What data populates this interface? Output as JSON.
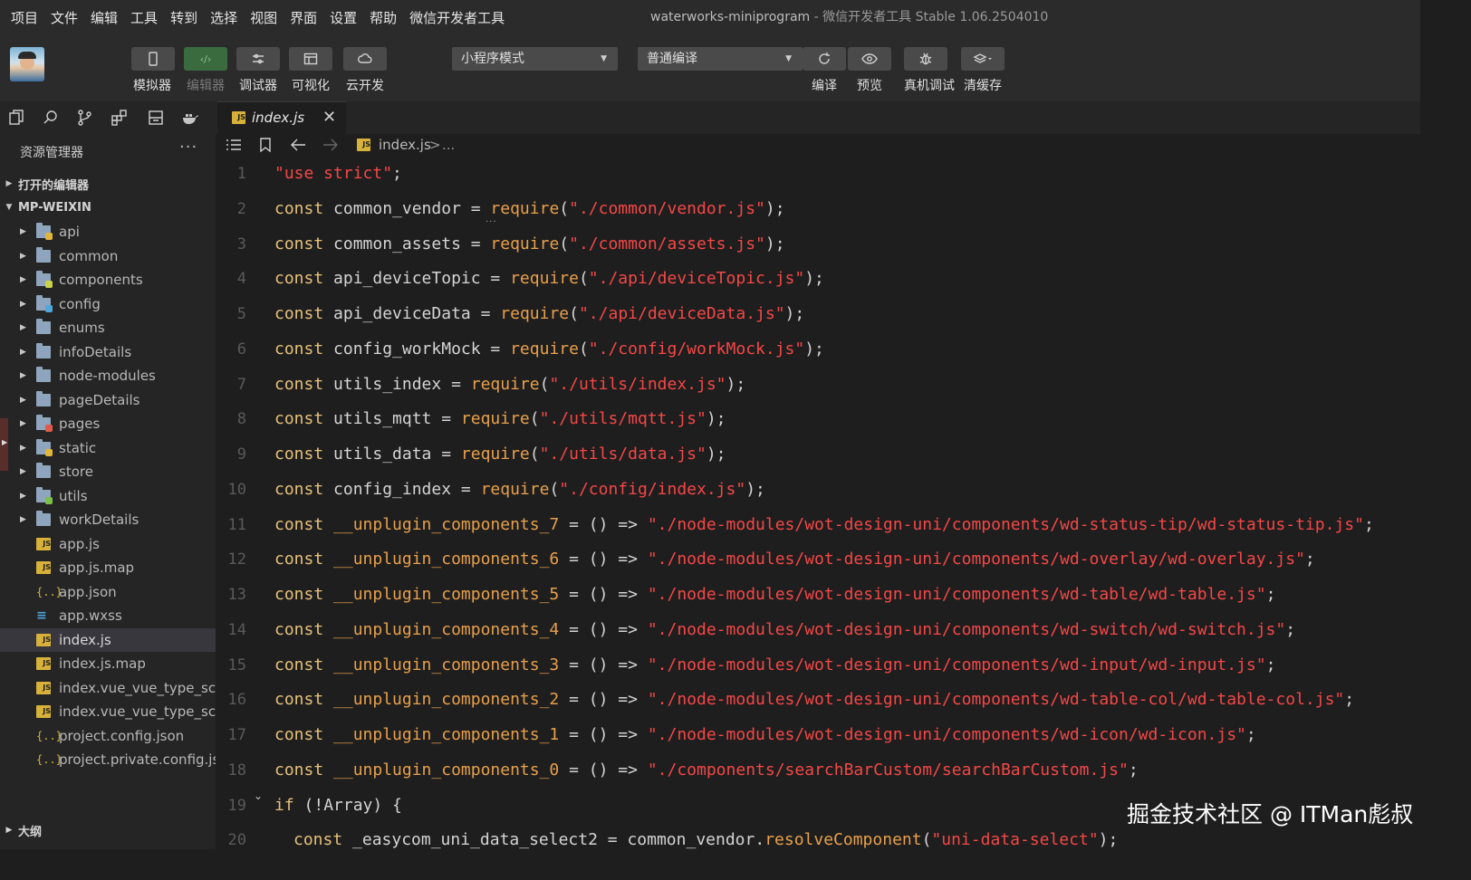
{
  "menu": [
    "项目",
    "文件",
    "编辑",
    "工具",
    "转到",
    "选择",
    "视图",
    "界面",
    "设置",
    "帮助",
    "微信开发者工具"
  ],
  "window_title": {
    "main": "waterworks-miniprogram",
    "rest": " - 微信开发者工具 Stable 1.06.2504010"
  },
  "toolbar": {
    "simulator": "模拟器",
    "editor": "编辑器",
    "debugger": "调试器",
    "visual": "可视化",
    "cloud": "云开发",
    "mode": "小程序模式",
    "compile_mode": "普通编译",
    "compile": "编译",
    "preview": "预览",
    "real_debug": "真机调试",
    "clear_cache": "清缓存"
  },
  "sidebar": {
    "title": "资源管理器",
    "more": "···",
    "open_editors": "打开的编辑器",
    "project": "MP-WEIXIN",
    "outline": "大纲",
    "items": [
      {
        "name": "api",
        "kind": "folder",
        "badge": "#e0b53a"
      },
      {
        "name": "common",
        "kind": "folder",
        "badge": ""
      },
      {
        "name": "components",
        "kind": "folder",
        "badge": "#c8d24a"
      },
      {
        "name": "config",
        "kind": "folder",
        "badge": "#4ea6dc"
      },
      {
        "name": "enums",
        "kind": "folder",
        "badge": ""
      },
      {
        "name": "infoDetails",
        "kind": "folder",
        "badge": ""
      },
      {
        "name": "node-modules",
        "kind": "folder",
        "badge": ""
      },
      {
        "name": "pageDetails",
        "kind": "folder",
        "badge": ""
      },
      {
        "name": "pages",
        "kind": "folder",
        "badge": "#e05a4a"
      },
      {
        "name": "static",
        "kind": "folder",
        "badge": "#e0b53a"
      },
      {
        "name": "store",
        "kind": "folder",
        "badge": ""
      },
      {
        "name": "utils",
        "kind": "folder",
        "badge": "#7cc04a"
      },
      {
        "name": "workDetails",
        "kind": "folder",
        "badge": ""
      },
      {
        "name": "app.js",
        "kind": "js"
      },
      {
        "name": "app.js.map",
        "kind": "js"
      },
      {
        "name": "app.json",
        "kind": "json"
      },
      {
        "name": "app.wxss",
        "kind": "css"
      },
      {
        "name": "index.js",
        "kind": "js",
        "selected": true
      },
      {
        "name": "index.js.map",
        "kind": "js"
      },
      {
        "name": "index.vue_vue_type_scr...",
        "kind": "js"
      },
      {
        "name": "index.vue_vue_type_scr...",
        "kind": "js"
      },
      {
        "name": "project.config.json",
        "kind": "json"
      },
      {
        "name": "project.private.config.js...",
        "kind": "json"
      }
    ]
  },
  "editor": {
    "tab": "index.js",
    "breadcrumb_file": "index.js",
    "breadcrumb_sep": ">",
    "breadcrumb_more": "...",
    "lines": [
      [
        [
          "s",
          "\"use strict\""
        ],
        [
          "n",
          ";"
        ]
      ],
      [
        [
          "k",
          "const"
        ],
        [
          "v",
          " common_vendor = "
        ],
        [
          "f",
          "require"
        ],
        [
          "n",
          "("
        ],
        [
          "s",
          "\"./common/vendor.js\""
        ],
        [
          "n",
          ");"
        ]
      ],
      [
        [
          "k",
          "const"
        ],
        [
          "v",
          " common_assets = "
        ],
        [
          "f",
          "require"
        ],
        [
          "n",
          "("
        ],
        [
          "s",
          "\"./common/assets.js\""
        ],
        [
          "n",
          ");"
        ]
      ],
      [
        [
          "k",
          "const"
        ],
        [
          "v",
          " api_deviceTopic = "
        ],
        [
          "f",
          "require"
        ],
        [
          "n",
          "("
        ],
        [
          "s",
          "\"./api/deviceTopic.js\""
        ],
        [
          "n",
          ");"
        ]
      ],
      [
        [
          "k",
          "const"
        ],
        [
          "v",
          " api_deviceData = "
        ],
        [
          "f",
          "require"
        ],
        [
          "n",
          "("
        ],
        [
          "s",
          "\"./api/deviceData.js\""
        ],
        [
          "n",
          ");"
        ]
      ],
      [
        [
          "k",
          "const"
        ],
        [
          "v",
          " config_workMock = "
        ],
        [
          "f",
          "require"
        ],
        [
          "n",
          "("
        ],
        [
          "s",
          "\"./config/workMock.js\""
        ],
        [
          "n",
          ");"
        ]
      ],
      [
        [
          "k",
          "const"
        ],
        [
          "v",
          " utils_index = "
        ],
        [
          "f",
          "require"
        ],
        [
          "n",
          "("
        ],
        [
          "s",
          "\"./utils/index.js\""
        ],
        [
          "n",
          ");"
        ]
      ],
      [
        [
          "k",
          "const"
        ],
        [
          "v",
          " utils_mqtt = "
        ],
        [
          "f",
          "require"
        ],
        [
          "n",
          "("
        ],
        [
          "s",
          "\"./utils/mqtt.js\""
        ],
        [
          "n",
          ");"
        ]
      ],
      [
        [
          "k",
          "const"
        ],
        [
          "v",
          " utils_data = "
        ],
        [
          "f",
          "require"
        ],
        [
          "n",
          "("
        ],
        [
          "s",
          "\"./utils/data.js\""
        ],
        [
          "n",
          ");"
        ]
      ],
      [
        [
          "k",
          "const"
        ],
        [
          "v",
          " config_index = "
        ],
        [
          "f",
          "require"
        ],
        [
          "n",
          "("
        ],
        [
          "s",
          "\"./config/index.js\""
        ],
        [
          "n",
          ");"
        ]
      ],
      [
        [
          "k",
          "const"
        ],
        [
          "f",
          " __unplugin_components_7"
        ],
        [
          "v",
          " = () => "
        ],
        [
          "s",
          "\"./node-modules/wot-design-uni/components/wd-status-tip/wd-status-tip.js\""
        ],
        [
          "n",
          ";"
        ]
      ],
      [
        [
          "k",
          "const"
        ],
        [
          "f",
          " __unplugin_components_6"
        ],
        [
          "v",
          " = () => "
        ],
        [
          "s",
          "\"./node-modules/wot-design-uni/components/wd-overlay/wd-overlay.js\""
        ],
        [
          "n",
          ";"
        ]
      ],
      [
        [
          "k",
          "const"
        ],
        [
          "f",
          " __unplugin_components_5"
        ],
        [
          "v",
          " = () => "
        ],
        [
          "s",
          "\"./node-modules/wot-design-uni/components/wd-table/wd-table.js\""
        ],
        [
          "n",
          ";"
        ]
      ],
      [
        [
          "k",
          "const"
        ],
        [
          "f",
          " __unplugin_components_4"
        ],
        [
          "v",
          " = () => "
        ],
        [
          "s",
          "\"./node-modules/wot-design-uni/components/wd-switch/wd-switch.js\""
        ],
        [
          "n",
          ";"
        ]
      ],
      [
        [
          "k",
          "const"
        ],
        [
          "f",
          " __unplugin_components_3"
        ],
        [
          "v",
          " = () => "
        ],
        [
          "s",
          "\"./node-modules/wot-design-uni/components/wd-input/wd-input.js\""
        ],
        [
          "n",
          ";"
        ]
      ],
      [
        [
          "k",
          "const"
        ],
        [
          "f",
          " __unplugin_components_2"
        ],
        [
          "v",
          " = () => "
        ],
        [
          "s",
          "\"./node-modules/wot-design-uni/components/wd-table-col/wd-table-col.js\""
        ],
        [
          "n",
          ";"
        ]
      ],
      [
        [
          "k",
          "const"
        ],
        [
          "f",
          " __unplugin_components_1"
        ],
        [
          "v",
          " = () => "
        ],
        [
          "s",
          "\"./node-modules/wot-design-uni/components/wd-icon/wd-icon.js\""
        ],
        [
          "n",
          ";"
        ]
      ],
      [
        [
          "k",
          "const"
        ],
        [
          "f",
          " __unplugin_components_0"
        ],
        [
          "v",
          " = () => "
        ],
        [
          "s",
          "\"./components/searchBarCustom/searchBarCustom.js\""
        ],
        [
          "n",
          ";"
        ]
      ],
      [
        [
          "k",
          "if"
        ],
        [
          "v",
          " (!Array) {"
        ]
      ],
      [
        [
          "k",
          "const"
        ],
        [
          "v",
          " _easycom_uni_data_select2 = common_vendor."
        ],
        [
          "f",
          "resolveComponent"
        ],
        [
          "n",
          "("
        ],
        [
          "s",
          "\"uni-data-select\""
        ],
        [
          "n",
          ");"
        ]
      ]
    ]
  },
  "watermark": "掘金技术社区 @ ITMan彪叔"
}
